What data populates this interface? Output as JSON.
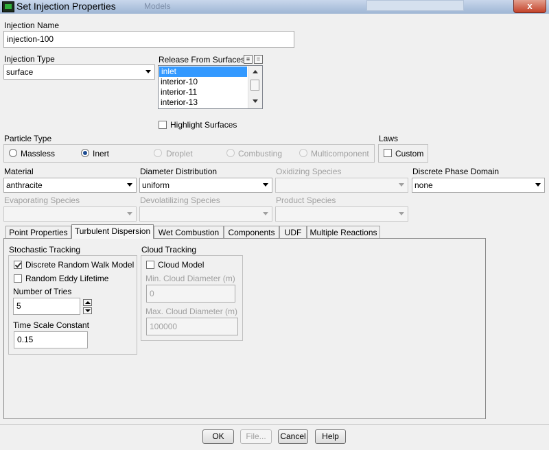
{
  "window": {
    "title": "Set Injection Properties",
    "background_text": "Models",
    "close_label": "x"
  },
  "injection_name": {
    "label": "Injection Name",
    "value": "injection-100"
  },
  "injection_type": {
    "label": "Injection Type",
    "value": "surface"
  },
  "release_from_surfaces": {
    "label": "Release From Surfaces",
    "items": [
      "inlet",
      "interior-10",
      "interior-11",
      "interior-13"
    ],
    "selected": "inlet"
  },
  "highlight_surfaces": {
    "label": "Highlight Surfaces",
    "checked": false
  },
  "particle_type": {
    "label": "Particle Type",
    "options": [
      "Massless",
      "Inert",
      "Droplet",
      "Combusting",
      "Multicomponent"
    ],
    "selected": "Inert"
  },
  "laws": {
    "label": "Laws",
    "custom_label": "Custom",
    "checked": false
  },
  "material": {
    "label": "Material",
    "value": "anthracite"
  },
  "diameter_distribution": {
    "label": "Diameter Distribution",
    "value": "uniform"
  },
  "oxidizing_species": {
    "label": "Oxidizing Species",
    "value": ""
  },
  "discrete_phase_domain": {
    "label": "Discrete Phase Domain",
    "value": "none"
  },
  "evaporating_species": {
    "label": "Evaporating Species",
    "value": ""
  },
  "devolatilizing_species": {
    "label": "Devolatilizing Species",
    "value": ""
  },
  "product_species": {
    "label": "Product Species",
    "value": ""
  },
  "tabs": [
    "Point Properties",
    "Turbulent Dispersion",
    "Wet Combustion",
    "Components",
    "UDF",
    "Multiple Reactions"
  ],
  "active_tab": "Turbulent Dispersion",
  "stochastic": {
    "label": "Stochastic Tracking",
    "discrete_random_walk": {
      "label": "Discrete Random Walk Model",
      "checked": true
    },
    "random_eddy": {
      "label": "Random Eddy Lifetime",
      "checked": false
    },
    "tries_label": "Number of Tries",
    "tries_value": "5",
    "time_scale_label": "Time Scale Constant",
    "time_scale_value": "0.15"
  },
  "cloud": {
    "label": "Cloud Tracking",
    "model": {
      "label": "Cloud Model",
      "checked": false
    },
    "min_label": "Min. Cloud Diameter (m)",
    "min_value": "0",
    "max_label": "Max. Cloud Diameter (m)",
    "max_value": "100000"
  },
  "buttons": {
    "ok": "OK",
    "file": "File...",
    "cancel": "Cancel",
    "help": "Help"
  }
}
